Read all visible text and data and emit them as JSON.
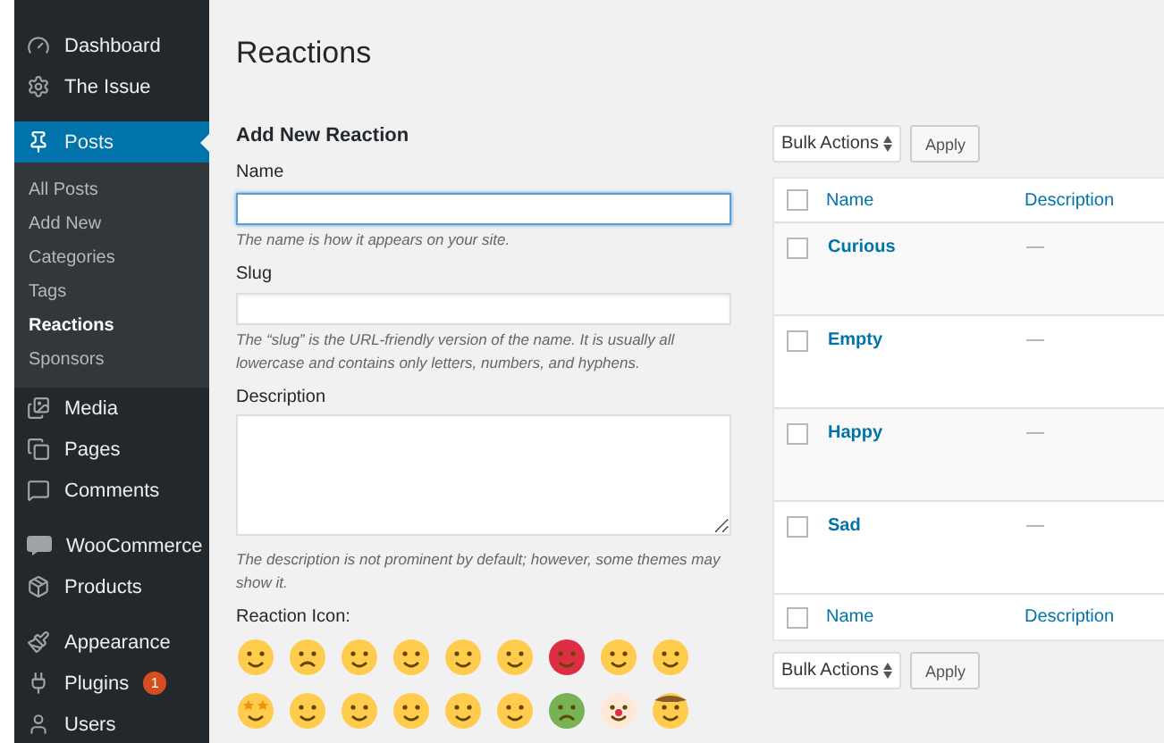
{
  "sidebar": {
    "groups": [
      {
        "items": [
          {
            "label": "Dashboard",
            "current": false
          },
          {
            "label": "The Issue",
            "current": false
          }
        ]
      },
      {
        "items": [
          {
            "label": "Posts",
            "current": true,
            "expanded": true,
            "children": [
              {
                "label": "All Posts",
                "selected": false
              },
              {
                "label": "Add New",
                "selected": false
              },
              {
                "label": "Categories",
                "selected": false
              },
              {
                "label": "Tags",
                "selected": false
              },
              {
                "label": "Reactions",
                "selected": true
              },
              {
                "label": "Sponsors",
                "selected": false
              }
            ]
          },
          {
            "label": "Media",
            "current": false
          },
          {
            "label": "Pages",
            "current": false
          },
          {
            "label": "Comments",
            "current": false
          }
        ]
      },
      {
        "items": [
          {
            "label": "WooCommerce",
            "current": false
          },
          {
            "label": "Products",
            "current": false
          }
        ]
      },
      {
        "items": [
          {
            "label": "Appearance",
            "current": false
          },
          {
            "label": "Plugins",
            "current": false,
            "badge": "1"
          },
          {
            "label": "Users",
            "current": false
          }
        ]
      }
    ]
  },
  "page_title": "Reactions",
  "form": {
    "heading": "Add New Reaction",
    "fields": [
      {
        "kind": "input",
        "label": "Name",
        "focused": true,
        "help": "The name is how it appears on your site."
      },
      {
        "kind": "input",
        "label": "Slug",
        "focused": false,
        "help": "The “slug” is the URL-friendly version of the name. It is usually all lowercase and contains only letters, numbers, and hyphens."
      },
      {
        "kind": "textarea",
        "label": "Description",
        "focused": false,
        "help": "The description is not prominent by default; however, some themes may show it."
      }
    ],
    "icons_label": "Reaction Icon:",
    "icons": [
      {
        "kind": "blush"
      },
      {
        "kind": "frown"
      },
      {
        "kind": "monocle"
      },
      {
        "kind": "mindblown"
      },
      {
        "kind": "vomit"
      },
      {
        "kind": "giggle"
      },
      {
        "kind": "angry"
      },
      {
        "kind": "shush"
      },
      {
        "kind": "zany"
      },
      {
        "kind": "starstruck"
      },
      {
        "kind": "eyebrow"
      },
      {
        "kind": "sneeze"
      },
      {
        "kind": "lying"
      },
      {
        "kind": "drool"
      },
      {
        "kind": "rofl"
      },
      {
        "kind": "sick"
      },
      {
        "kind": "clown"
      },
      {
        "kind": "cowboy"
      }
    ]
  },
  "bulk_top": {
    "select": "Bulk Actions",
    "button": "Apply"
  },
  "table": {
    "columns": [
      "Name",
      "Description"
    ],
    "header_checked": false,
    "rows": [
      {
        "name": "Curious",
        "description": "—",
        "checked": false
      },
      {
        "name": "Empty",
        "description": "—",
        "checked": false
      },
      {
        "name": "Happy",
        "description": "—",
        "checked": false
      },
      {
        "name": "Sad",
        "description": "—",
        "checked": false
      }
    ],
    "footer_columns": [
      "Name",
      "Description"
    ],
    "footer_checked": false
  },
  "bulk_bottom": {
    "select": "Bulk Actions",
    "button": "Apply"
  }
}
